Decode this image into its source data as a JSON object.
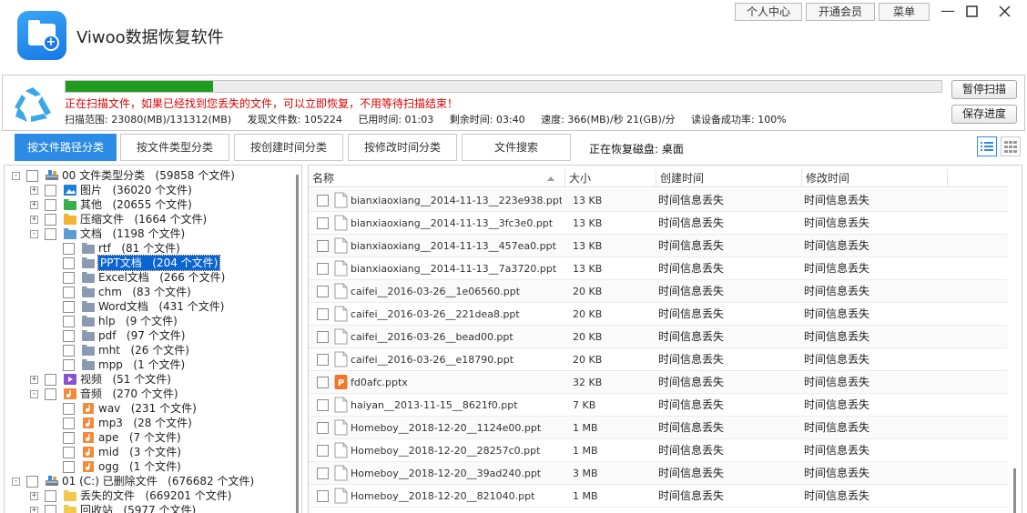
{
  "app": {
    "title": "Viwoo数据恢复软件",
    "logo_icon": "folder-plus-icon",
    "brand_color": "#1778e6"
  },
  "header": {
    "personal_center": "个人中心",
    "vip": "开通会员",
    "menu": "菜单"
  },
  "scan": {
    "progress": 0.168,
    "progress_color": "#1f9b1f",
    "warning": "正在扫描文件，如果已经找到您丢失的文件，可以立即恢复，不用等待扫描结束！",
    "warning_color": "#e00000",
    "range": "扫描范围: 23080(MB)/131312(MB)",
    "found": "发现文件数: 105224",
    "elapsed": "已用时间: 01:03",
    "remaining": "剩余时间: 03:40",
    "speed": "速度: 366(MB)/秒  21(GB)/分",
    "read_rate": "读设备成功率: 100%",
    "pause_button": "暂停扫描",
    "save_button": "保存进度"
  },
  "tabs": [
    {
      "label": "按文件路径分类",
      "active": true
    },
    {
      "label": "按文件类型分类",
      "active": false
    },
    {
      "label": "按创建时间分类",
      "active": false
    },
    {
      "label": "按修改时间分类",
      "active": false
    },
    {
      "label": "文件搜索",
      "active": false
    }
  ],
  "restoring_disk": "正在恢复磁盘: 桌面",
  "tree": [
    {
      "label": "00 文件类型分类",
      "count": "(59858 个文件)",
      "level": 0,
      "expander": "-",
      "icon": "drive-icon"
    },
    {
      "label": "图片",
      "count": "(36020 个文件)",
      "level": 1,
      "expander": "+",
      "icon": "image-folder-icon"
    },
    {
      "label": "其他",
      "count": "(20655 个文件)",
      "level": 1,
      "expander": "+",
      "icon": "other-folder-icon"
    },
    {
      "label": "压缩文件",
      "count": "(1664 个文件)",
      "level": 1,
      "expander": "+",
      "icon": "archive-folder-icon"
    },
    {
      "label": "文档",
      "count": "(1198 个文件)",
      "level": 1,
      "expander": "-",
      "icon": "doc-folder-icon"
    },
    {
      "label": "rtf",
      "count": "(81 个文件)",
      "level": 2,
      "expander": "",
      "icon": "folder-icon"
    },
    {
      "label": "PPT文档",
      "count": "(204 个文件)",
      "level": 2,
      "expander": "",
      "icon": "folder-icon",
      "selected": true
    },
    {
      "label": "Excel文档",
      "count": "(266 个文件)",
      "level": 2,
      "expander": "",
      "icon": "folder-icon"
    },
    {
      "label": "chm",
      "count": "(83 个文件)",
      "level": 2,
      "expander": "",
      "icon": "folder-icon"
    },
    {
      "label": "Word文档",
      "count": "(431 个文件)",
      "level": 2,
      "expander": "",
      "icon": "folder-icon"
    },
    {
      "label": "hlp",
      "count": "(9 个文件)",
      "level": 2,
      "expander": "",
      "icon": "folder-icon"
    },
    {
      "label": "pdf",
      "count": "(97 个文件)",
      "level": 2,
      "expander": "",
      "icon": "folder-icon"
    },
    {
      "label": "mht",
      "count": "(26 个文件)",
      "level": 2,
      "expander": "",
      "icon": "folder-icon"
    },
    {
      "label": "mpp",
      "count": "(1 个文件)",
      "level": 2,
      "expander": "",
      "icon": "folder-icon"
    },
    {
      "label": "视频",
      "count": "(51 个文件)",
      "level": 1,
      "expander": "+",
      "icon": "video-folder-icon"
    },
    {
      "label": "音频",
      "count": "(270 个文件)",
      "level": 1,
      "expander": "-",
      "icon": "audio-folder-icon"
    },
    {
      "label": "wav",
      "count": "(231 个文件)",
      "level": 2,
      "expander": "",
      "icon": "audio-file-icon"
    },
    {
      "label": "mp3",
      "count": "(28 个文件)",
      "level": 2,
      "expander": "",
      "icon": "audio-file-icon"
    },
    {
      "label": "ape",
      "count": "(7 个文件)",
      "level": 2,
      "expander": "",
      "icon": "audio-file-icon"
    },
    {
      "label": "mid",
      "count": "(3 个文件)",
      "level": 2,
      "expander": "",
      "icon": "audio-file-icon"
    },
    {
      "label": "ogg",
      "count": "(1 个文件)",
      "level": 2,
      "expander": "",
      "icon": "audio-file-icon"
    },
    {
      "label": "01 (C:) 已删除文件",
      "count": "(676682 个文件)",
      "level": 0,
      "expander": "-",
      "icon": "drive-icon"
    },
    {
      "label": "丢失的文件",
      "count": "(669201 个文件)",
      "level": 1,
      "expander": "+",
      "icon": "folder-icon-yellow"
    },
    {
      "label": "回收站",
      "count": "(5977 个文件)",
      "level": 1,
      "expander": "+",
      "icon": "folder-icon-yellow"
    }
  ],
  "table": {
    "columns": [
      "名称",
      "大小",
      "创建时间",
      "修改时间"
    ],
    "rows": [
      {
        "name": "bianxiaoxiang__2014-11-13__223e938.ppt",
        "size": "13 KB",
        "created": "时间信息丢失",
        "modified": "时间信息丢失",
        "icon": "file-icon"
      },
      {
        "name": "bianxiaoxiang__2014-11-13__3fc3e0.ppt",
        "size": "13 KB",
        "created": "时间信息丢失",
        "modified": "时间信息丢失",
        "icon": "file-icon"
      },
      {
        "name": "bianxiaoxiang__2014-11-13__457ea0.ppt",
        "size": "13 KB",
        "created": "时间信息丢失",
        "modified": "时间信息丢失",
        "icon": "file-icon"
      },
      {
        "name": "bianxiaoxiang__2014-11-13__7a3720.ppt",
        "size": "13 KB",
        "created": "时间信息丢失",
        "modified": "时间信息丢失",
        "icon": "file-icon"
      },
      {
        "name": "caifei__2016-03-26__1e06560.ppt",
        "size": "20 KB",
        "created": "时间信息丢失",
        "modified": "时间信息丢失",
        "icon": "file-icon"
      },
      {
        "name": "caifei__2016-03-26__221dea8.ppt",
        "size": "20 KB",
        "created": "时间信息丢失",
        "modified": "时间信息丢失",
        "icon": "file-icon"
      },
      {
        "name": "caifei__2016-03-26__bead00.ppt",
        "size": "20 KB",
        "created": "时间信息丢失",
        "modified": "时间信息丢失",
        "icon": "file-icon"
      },
      {
        "name": "caifei__2016-03-26__e18790.ppt",
        "size": "20 KB",
        "created": "时间信息丢失",
        "modified": "时间信息丢失",
        "icon": "file-icon"
      },
      {
        "name": "fd0afc.pptx",
        "size": "32 KB",
        "created": "时间信息丢失",
        "modified": "时间信息丢失",
        "icon": "pptx-icon"
      },
      {
        "name": "haiyan__2013-11-15__8621f0.ppt",
        "size": "7 KB",
        "created": "时间信息丢失",
        "modified": "时间信息丢失",
        "icon": "file-icon"
      },
      {
        "name": "Homeboy__2018-12-20__1124e00.ppt",
        "size": "1 MB",
        "created": "时间信息丢失",
        "modified": "时间信息丢失",
        "icon": "file-icon"
      },
      {
        "name": "Homeboy__2018-12-20__28257c0.ppt",
        "size": "1 MB",
        "created": "时间信息丢失",
        "modified": "时间信息丢失",
        "icon": "file-icon"
      },
      {
        "name": "Homeboy__2018-12-20__39ad240.ppt",
        "size": "3 MB",
        "created": "时间信息丢失",
        "modified": "时间信息丢失",
        "icon": "file-icon"
      },
      {
        "name": "Homeboy__2018-12-20__821040.ppt",
        "size": "1 MB",
        "created": "时间信息丢失",
        "modified": "时间信息丢失",
        "icon": "file-icon"
      }
    ]
  }
}
